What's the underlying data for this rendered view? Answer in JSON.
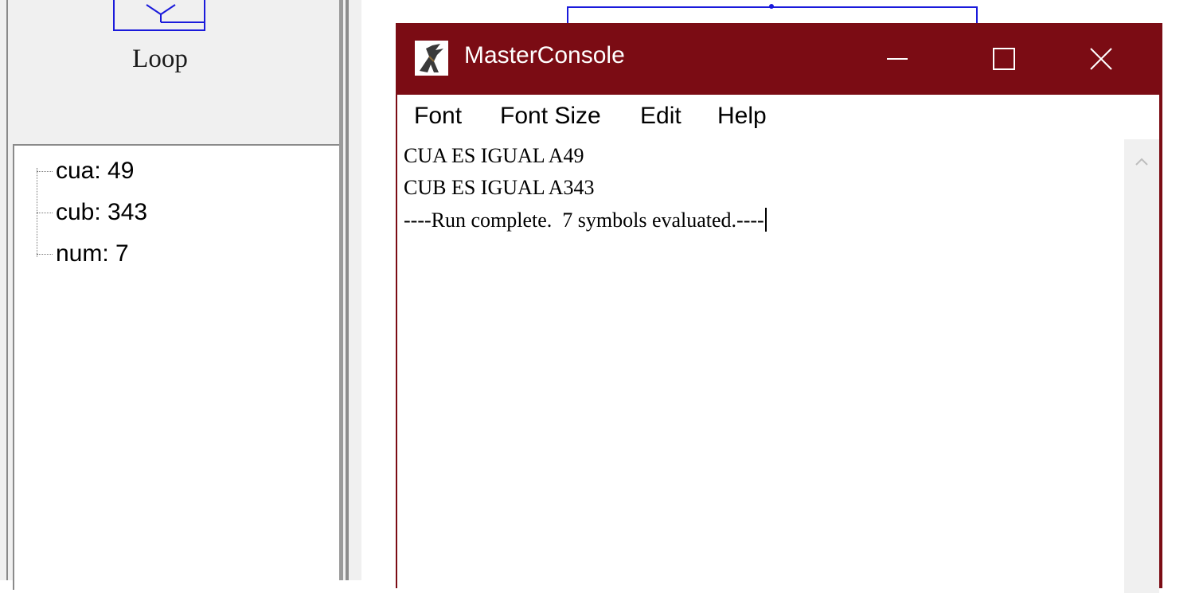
{
  "palette": {
    "loop_label": "Loop"
  },
  "variables": [
    {
      "text": "cua: 49"
    },
    {
      "text": "cub: 343"
    },
    {
      "text": "num: 7"
    }
  ],
  "console": {
    "title": "MasterConsole",
    "icon": "raptor-icon",
    "controls": {
      "minimize": "minimize-icon",
      "maximize": "maximize-icon",
      "close": "close-icon"
    },
    "menu": [
      "Font",
      "Font Size",
      "Edit",
      "Help"
    ],
    "output_lines": [
      "CUA ES IGUAL A49",
      "CUB ES IGUAL A343",
      "----Run complete.  7 symbols evaluated.----"
    ]
  },
  "colors": {
    "titlebar": "#7b0c14",
    "canvas_lines": "#1a1adb"
  }
}
